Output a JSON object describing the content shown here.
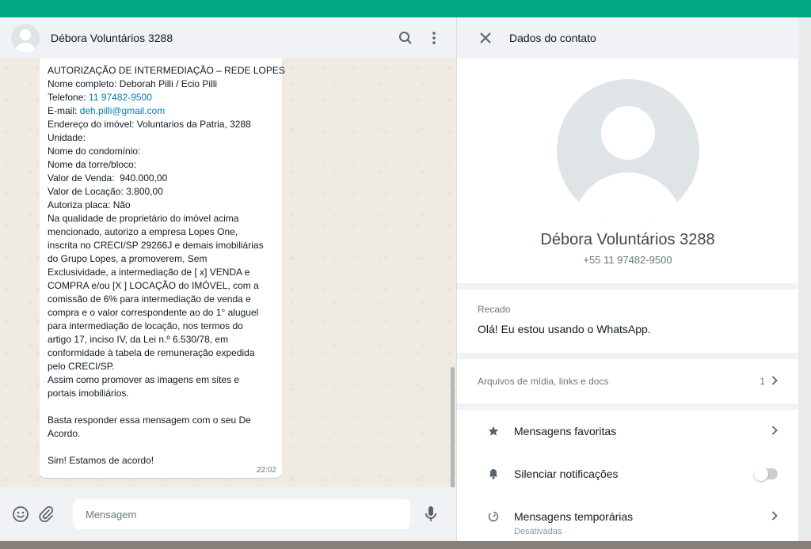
{
  "chat": {
    "title": "Débora Voluntários 3288",
    "message": {
      "lines": [
        "AUTORIZAÇÃO DE INTERMEDIAÇÃO – REDE LOPES",
        "Nome completo: Deborah Pilli / Ecio Pilli",
        "Telefone: ",
        "E-mail: ",
        "Endereço do imóvel: Voluntarios da Patria, 3288",
        "Unidade:",
        "Nome do condomínio:",
        "Nome da torre/bloco:",
        "Valor de Venda:  940.000,00",
        "Valor de Locação: 3.800,00",
        "Autoriza placa: Não",
        "Na qualidade de proprietário do imóvel acima",
        "mencionado, autorizo a empresa Lopes One,",
        "inscrita no CRECI/SP 29266J e demais imobiliárias",
        "do Grupo Lopes, a promoverem, Sem",
        "Exclusividade, a intermediação de [ x] VENDA e",
        "COMPRA e/ou [X ] LOCAÇÃO do IMÓVEL, com a",
        "comissão de 6% para intermediação de venda e",
        "compra e o valor correspondente ao do 1° aluguel",
        "para intermediação de locação, nos termos do",
        "artigo 17, inciso IV, da Lei n.º 6.530/78, em",
        "conformidade à tabela de remuneração expedida",
        "pelo CRECI/SP.",
        "Assim como promover as imagens em sites e",
        "portais imobiliários.",
        "",
        "Basta responder essa mensagem com o seu De",
        "Acordo.",
        "",
        "Sim! Estamos de acordo!"
      ],
      "phone_link": "11 97482-9500",
      "email_link": "deh.pilli@gmail.com",
      "time": "22:02"
    },
    "composer": {
      "placeholder": "Mensagem"
    }
  },
  "contact": {
    "header_title": "Dados do contato",
    "name": "Débora Voluntários 3288",
    "phone": "+55 11 97482-9500",
    "about_label": "Recado",
    "about_text": "Olá! Eu estou usando o WhatsApp.",
    "media_label": "Arquivos de mídia, links e docs",
    "media_count": "1",
    "options": [
      {
        "label": "Mensagens favoritas",
        "icon": "star-icon"
      },
      {
        "label": "Silenciar notificações",
        "icon": "bell-icon"
      },
      {
        "label": "Mensagens temporárias",
        "sub": "Desativadas",
        "icon": "timer-icon"
      }
    ]
  }
}
